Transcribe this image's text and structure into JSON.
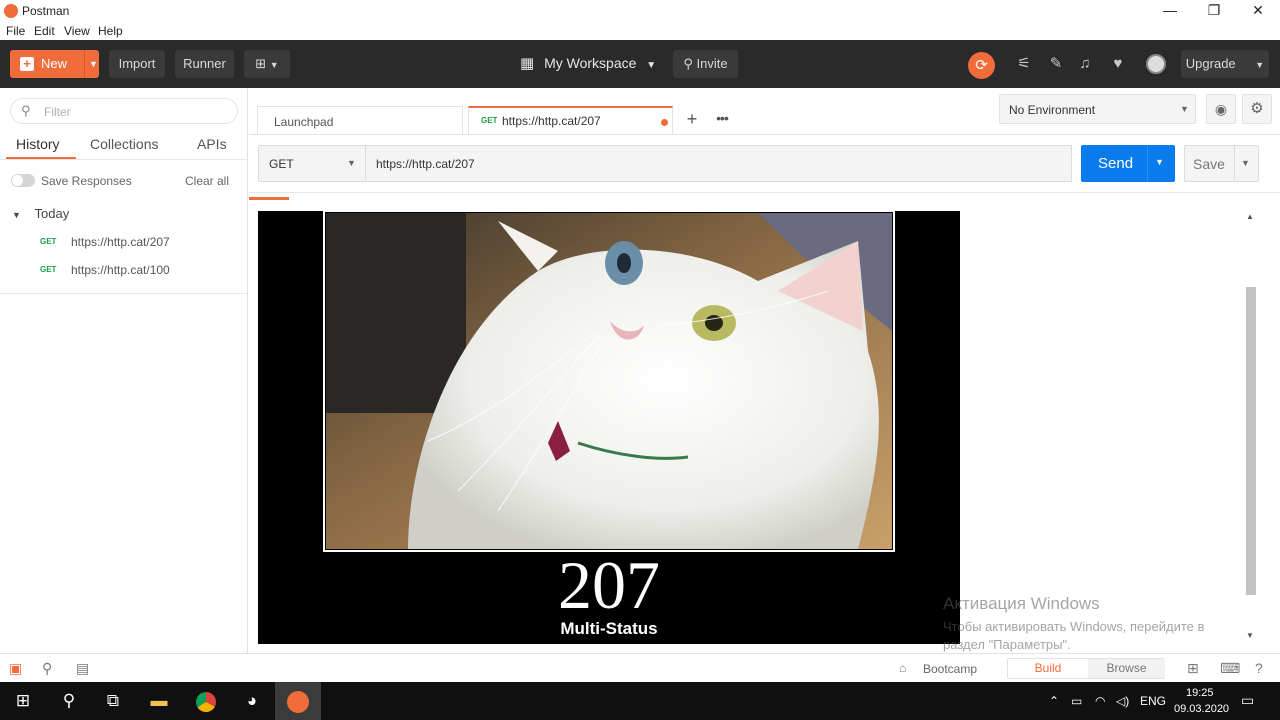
{
  "window": {
    "title": "Postman",
    "controls": [
      "—",
      "❐",
      "✕"
    ]
  },
  "menu": [
    "File",
    "Edit",
    "View",
    "Help"
  ],
  "toolbar": {
    "new_label": "New",
    "import_label": "Import",
    "runner_label": "Runner",
    "workspace_label": "My Workspace",
    "invite_label": "Invite",
    "upgrade_label": "Upgrade",
    "accent_color": "#f26b3a"
  },
  "sidebar": {
    "filter_placeholder": "Filter",
    "tabs": [
      "History",
      "Collections",
      "APIs"
    ],
    "save_responses_label": "Save Responses",
    "clear_all_label": "Clear all",
    "group_label": "Today",
    "history": [
      {
        "method": "GET",
        "url": "https://http.cat/207"
      },
      {
        "method": "GET",
        "url": "https://http.cat/100"
      }
    ]
  },
  "tabs": {
    "launchpad_label": "Launchpad",
    "active_method": "GET",
    "active_url": "https://http.cat/207"
  },
  "environment": {
    "selected": "No Environment"
  },
  "request": {
    "method": "GET",
    "url": "https://http.cat/207",
    "send_label": "Send",
    "save_label": "Save"
  },
  "response": {
    "status_code": "207",
    "status_text": "Multi-Status"
  },
  "watermark": {
    "heading": "Активация Windows",
    "line1": "Чтобы активировать Windows, перейдите в",
    "line2": "раздел \"Параметры\"."
  },
  "statusbar": {
    "bootcamp_label": "Bootcamp",
    "build_label": "Build",
    "browse_label": "Browse"
  },
  "taskbar": {
    "language": "ENG",
    "time": "19:25",
    "date": "09.03.2020"
  }
}
